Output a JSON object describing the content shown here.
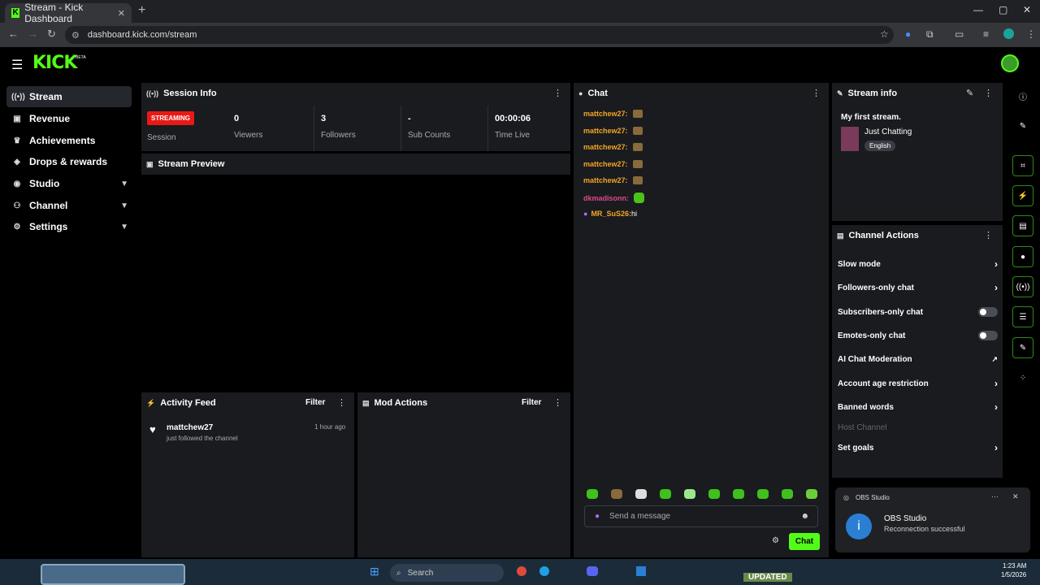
{
  "browser": {
    "tab_title": "Stream - Kick Dashboard",
    "url": "dashboard.kick.com/stream"
  },
  "header": {
    "logo": "KICK",
    "beta": "BETA"
  },
  "sidebar": {
    "items": [
      {
        "label": "Stream",
        "icon": "broadcast-icon"
      },
      {
        "label": "Revenue",
        "icon": "wallet-icon"
      },
      {
        "label": "Achievements",
        "icon": "trophy-icon"
      },
      {
        "label": "Drops & rewards",
        "icon": "gift-icon"
      },
      {
        "label": "Studio",
        "icon": "studio-icon"
      },
      {
        "label": "Channel",
        "icon": "channel-icon"
      },
      {
        "label": "Settings",
        "icon": "gear-icon"
      }
    ]
  },
  "session": {
    "title": "Session Info",
    "badge": "STREAMING",
    "badge_label": "Session",
    "stats": [
      {
        "value": "0",
        "label": "Viewers"
      },
      {
        "value": "3",
        "label": "Followers"
      },
      {
        "value": "-",
        "label": "Sub Counts"
      },
      {
        "value": "00:00:06",
        "label": "Time Live"
      }
    ]
  },
  "preview": {
    "title": "Stream Preview"
  },
  "activity": {
    "title": "Activity Feed",
    "filter": "Filter",
    "items": [
      {
        "user": "mattchew27",
        "time": "1 hour ago",
        "text": "just followed the channel"
      }
    ]
  },
  "mod": {
    "title": "Mod Actions",
    "filter": "Filter"
  },
  "chat": {
    "title": "Chat",
    "messages": [
      {
        "user": "mattchew27:",
        "text": "",
        "color": "#f5a623"
      },
      {
        "user": "mattchew27:",
        "text": "",
        "color": "#f5a623"
      },
      {
        "user": "mattchew27:",
        "text": "",
        "color": "#f5a623"
      },
      {
        "user": "mattchew27:",
        "text": "",
        "color": "#f5a623"
      },
      {
        "user": "mattchew27:",
        "text": "",
        "color": "#f5a623"
      },
      {
        "user": "dkmadisonn:",
        "text": "",
        "color": "#e0488b"
      },
      {
        "user": "MR_SuS26:",
        "text": " hi",
        "color": "#f5a623"
      }
    ],
    "placeholder": "Send a message",
    "send": "Chat"
  },
  "streaminfo": {
    "title": "Stream info",
    "stream_title": "My first stream.",
    "category": "Just Chatting",
    "language": "English"
  },
  "actions": {
    "title": "Channel Actions",
    "rows": [
      {
        "label": "Slow mode",
        "kind": "arrow"
      },
      {
        "label": "Followers-only chat",
        "kind": "arrow"
      },
      {
        "label": "Subscribers-only chat",
        "kind": "toggle"
      },
      {
        "label": "Emotes-only chat",
        "kind": "toggle"
      },
      {
        "label": "AI Chat Moderation",
        "kind": "external"
      },
      {
        "label": "Account age restriction",
        "kind": "arrow"
      },
      {
        "label": "Banned words",
        "kind": "arrow"
      },
      {
        "label": "Host Channel",
        "kind": "disabled"
      },
      {
        "label": "Set goals",
        "kind": "arrow"
      }
    ]
  },
  "toast": {
    "app": "OBS Studio",
    "title": "OBS Studio",
    "message": "Reconnection successful"
  },
  "taskbar": {
    "search": "Search",
    "time": "1:23 AM",
    "date": "1/5/2026",
    "thumb_label": "UPDATED"
  },
  "colors": {
    "accent": "#53fc18",
    "streaming": "#e91916",
    "panel": "#191b1f"
  }
}
